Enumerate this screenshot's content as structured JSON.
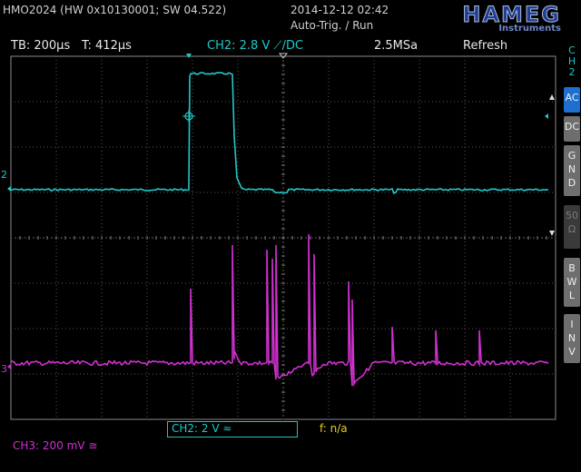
{
  "header": {
    "device": "HMO2024 (HW 0x10130001; SW 04.522)",
    "datetime": "2014-12-12 02:42",
    "trigger_mode": "Auto-Trig. / Run",
    "brand": "HAMEG",
    "brand_sub": "Instruments"
  },
  "info_bar": {
    "timebase": "TB: 200µs",
    "trigger_time": "T: 412µs",
    "trigger_channel": "CH2: 2.8 V ⟋/DC",
    "sample_rate": "2.5MSa",
    "acq_mode": "Refresh"
  },
  "sidebar": {
    "channel": [
      "C",
      "H",
      "2"
    ],
    "buttons": [
      {
        "label": [
          "AC"
        ],
        "active": true
      },
      {
        "label": [
          "DC"
        ],
        "active": false
      },
      {
        "label": [
          "G",
          "N",
          "D"
        ],
        "active": false
      },
      {
        "label": [
          "50",
          "Ω"
        ],
        "active": false,
        "disabled": true
      },
      {
        "label": [
          "B",
          "W",
          "L"
        ],
        "active": false
      },
      {
        "label": [
          "I",
          "N",
          "V"
        ],
        "active": false
      }
    ]
  },
  "bottom": {
    "ch2_scale": "CH2: 2 V ≈",
    "frequency": "f: n/a",
    "ch3_scale": "CH3: 200 mV ≅"
  },
  "markers": {
    "ch2_ref": "2",
    "ch3_ref": "3"
  },
  "colors": {
    "ch2": "#22c8c8",
    "ch3": "#d030d0",
    "grid": "#5a5a5a",
    "accent": "#1f6fd0"
  }
}
